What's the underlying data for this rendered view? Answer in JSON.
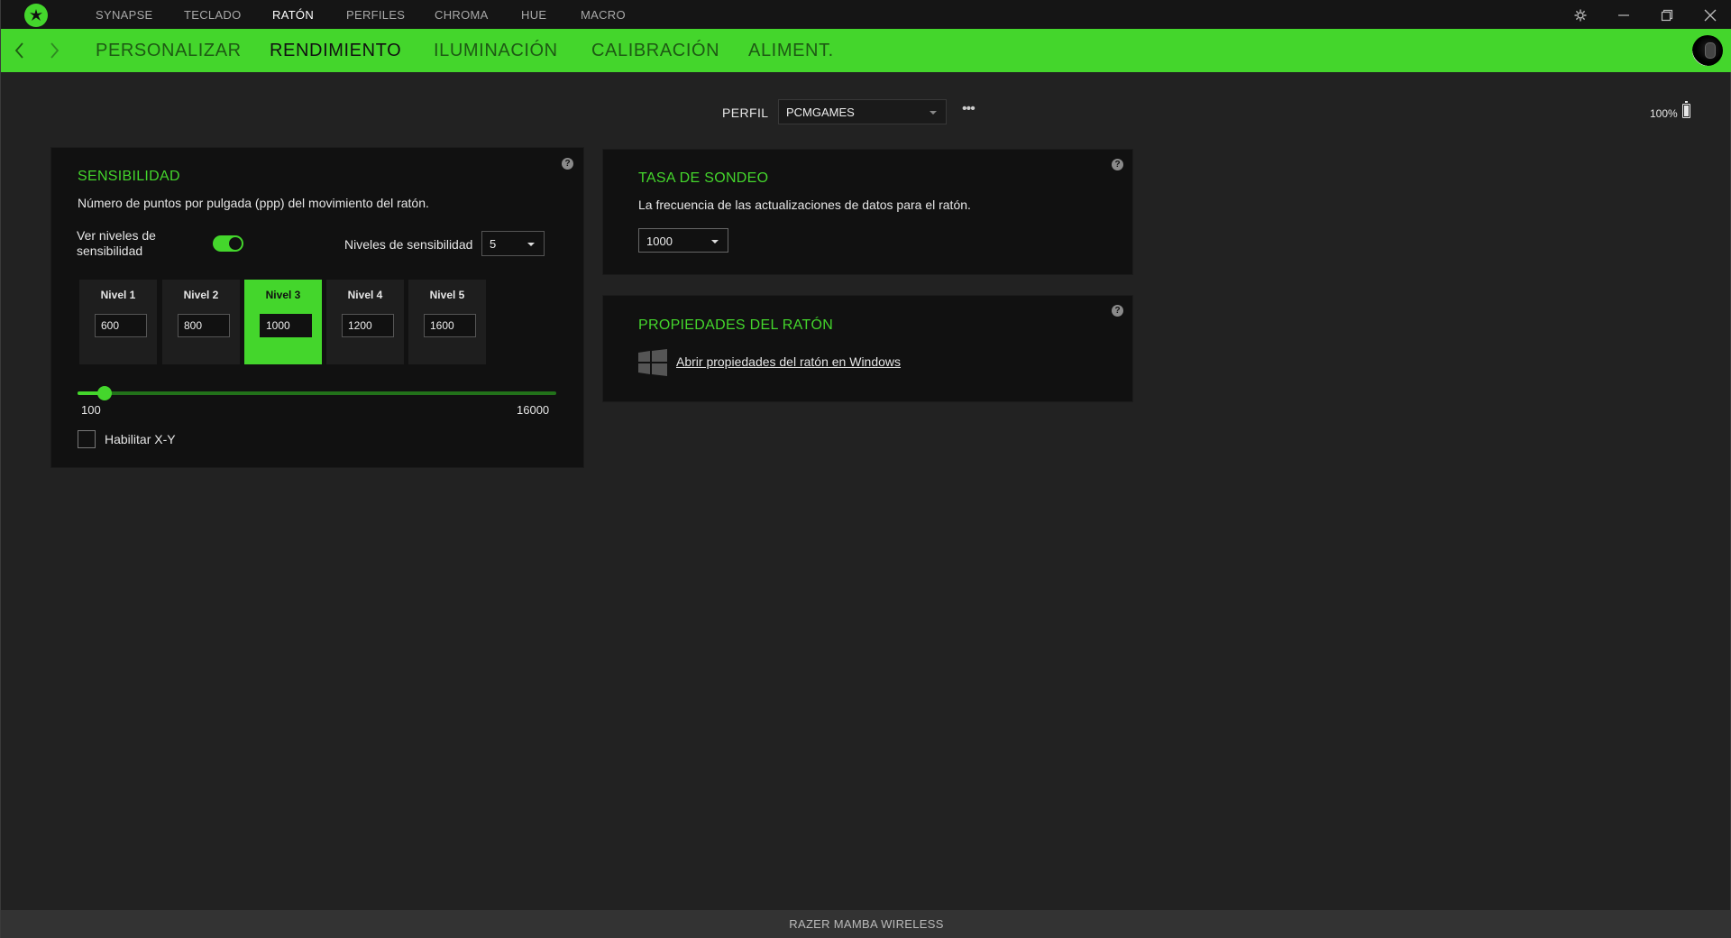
{
  "titlebar": {
    "nav": [
      {
        "label": "SYNAPSE",
        "active": false
      },
      {
        "label": "TECLADO",
        "active": false
      },
      {
        "label": "RATÓN",
        "active": true
      },
      {
        "label": "PERFILES",
        "active": false
      },
      {
        "label": "CHROMA",
        "active": false
      },
      {
        "label": "HUE",
        "active": false
      },
      {
        "label": "MACRO",
        "active": false
      }
    ],
    "icons": {
      "logo": "razer-logo-icon",
      "settings": "gear-icon",
      "minimize": "minimize-icon",
      "maximize": "restore-icon",
      "close": "close-icon"
    }
  },
  "subnav": {
    "items": [
      {
        "label": "PERSONALIZAR",
        "active": false
      },
      {
        "label": "RENDIMIENTO",
        "active": true
      },
      {
        "label": "ILUMINACIÓN",
        "active": false
      },
      {
        "label": "CALIBRACIÓN",
        "active": false
      },
      {
        "label": "ALIMENT.",
        "active": false
      }
    ]
  },
  "profile": {
    "label": "PERFIL",
    "value": "PCMGAMES",
    "more": "•••"
  },
  "battery": {
    "text": "100%",
    "level": 1.0
  },
  "sensitivity": {
    "title": "SENSIBILIDAD",
    "description": "Número de puntos por pulgada (ppp) del movimiento del ratón.",
    "toggle_label": "Ver niveles de sensibilidad",
    "toggle_on": true,
    "levels_label": "Niveles de sensibilidad",
    "levels_value": "5",
    "levels": [
      {
        "name": "Nivel 1",
        "value": "600",
        "active": false
      },
      {
        "name": "Nivel 2",
        "value": "800",
        "active": false
      },
      {
        "name": "Nivel 3",
        "value": "1000",
        "active": true
      },
      {
        "name": "Nivel 4",
        "value": "1200",
        "active": false
      },
      {
        "name": "Nivel 5",
        "value": "1600",
        "active": false
      }
    ],
    "slider_min": "100",
    "slider_max": "16000",
    "slider_value": 1000,
    "xy_label": "Habilitar X-Y",
    "xy_checked": false,
    "help": "?"
  },
  "polling": {
    "title": "TASA DE SONDEO",
    "description": "La frecuencia de las actualizaciones de datos para el ratón.",
    "value": "1000",
    "help": "?"
  },
  "mouse_properties": {
    "title": "PROPIEDADES DEL RATÓN",
    "link": "Abrir propiedades del ratón en Windows",
    "help": "?"
  },
  "footer": {
    "device": "RAZER MAMBA WIRELESS"
  },
  "colors": {
    "accent": "#44d62c",
    "background": "#222222",
    "panel": "#111111",
    "titlebar": "#151515"
  }
}
